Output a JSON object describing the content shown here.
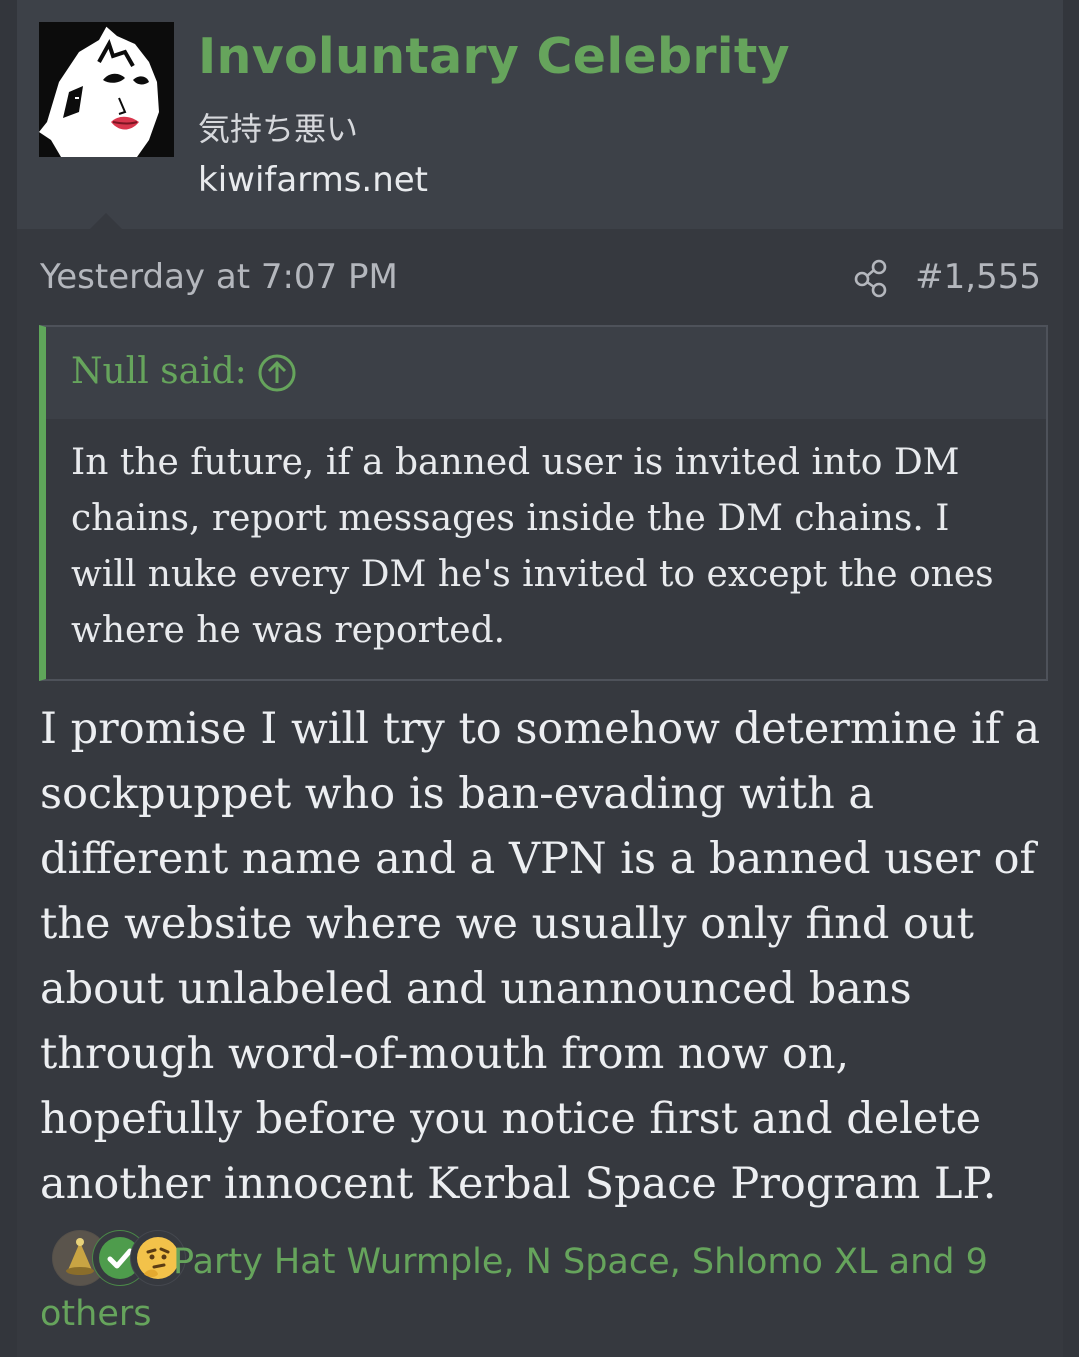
{
  "post": {
    "author": {
      "name": "Involuntary Celebrity",
      "title": "気持ち悪い",
      "site": "kiwifarms.net"
    },
    "date": "Yesterday at 7:07 PM",
    "post_number": "#1,555",
    "quote": {
      "author_label": "Null said:",
      "text": "In the future, if a banned user is invited into DM chains, report messages inside the DM chains. I will nuke every DM he's invited to except the ones where he was reported."
    },
    "body": "I promise I will try to somehow determine if a sockpuppet who is ban-evading with a different name and a VPN is a banned user of the website where we usually only find out about unlabeled and unannounced bans through word-of-mouth from now on, hopefully before you notice first and delete another innocent Kerbal Space Program LP.",
    "reactions": {
      "icons": [
        "hat-reaction-icon",
        "check-reaction-icon",
        "thinking-reaction-icon"
      ],
      "summary": "Party Hat Wurmple, N Space, Shlomo XL and 9 others"
    }
  },
  "colors": {
    "accent_green": "#66a45c",
    "quote_border": "#5fa65a",
    "background": "#36393f"
  }
}
